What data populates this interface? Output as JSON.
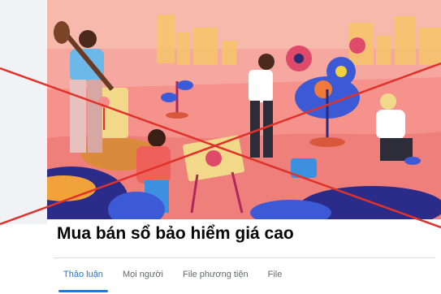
{
  "group": {
    "title": "Mua bán sổ bảo hiểm giá cao"
  },
  "tabs": [
    {
      "label": "Thảo luận",
      "active": true
    },
    {
      "label": "Mọi người",
      "active": false
    },
    {
      "label": "File phương tiện",
      "active": false
    },
    {
      "label": "File",
      "active": false
    }
  ],
  "colors": {
    "accent": "#1877f2",
    "cross": "#e0322a",
    "cover_sky": "#f6a8a0",
    "buildings": "#f7c56a"
  },
  "cover": {
    "description_icon": "community-garden-illustration"
  }
}
